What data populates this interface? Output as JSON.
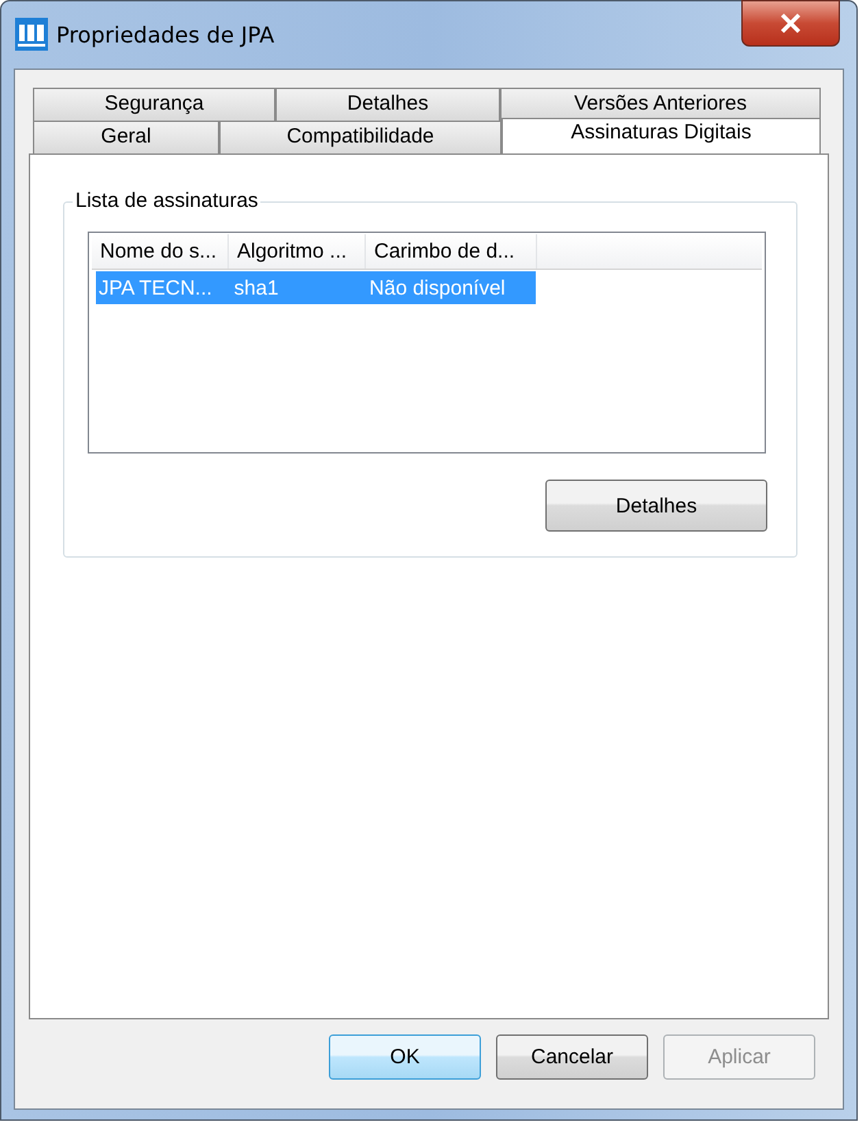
{
  "window": {
    "title": "Propriedades de JPA"
  },
  "tab_rows": [
    [
      {
        "label": "Segurança",
        "selected": false
      },
      {
        "label": "Detalhes",
        "selected": false
      },
      {
        "label": "Versões Anteriores",
        "selected": false
      }
    ],
    [
      {
        "label": "Geral",
        "selected": false
      },
      {
        "label": "Compatibilidade",
        "selected": false
      },
      {
        "label": "Assinaturas Digitais",
        "selected": true
      }
    ]
  ],
  "group": {
    "title": "Lista de assinaturas",
    "table": {
      "columns": [
        "Nome do s...",
        "Algoritmo ...",
        "Carimbo de d..."
      ],
      "rows": [
        {
          "cells": [
            "JPA TECN...",
            "sha1",
            "Não disponível"
          ],
          "selected": true
        }
      ]
    },
    "button": "Detalhes"
  },
  "buttons": [
    {
      "label": "OK",
      "default": true,
      "disabled": false
    },
    {
      "label": "Cancelar",
      "default": false,
      "disabled": false
    },
    {
      "label": "Aplicar",
      "default": false,
      "disabled": true
    }
  ]
}
